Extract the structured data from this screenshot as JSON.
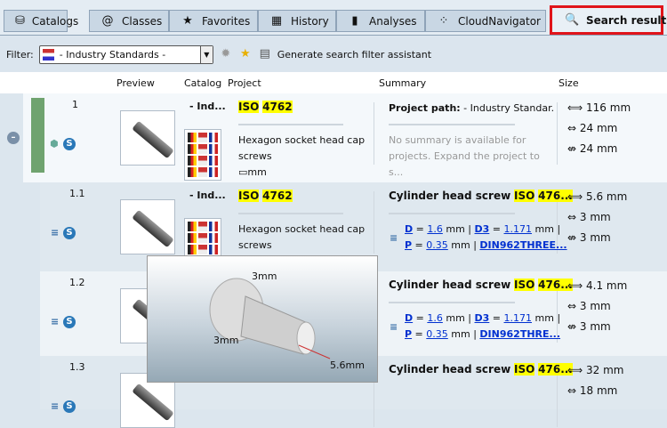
{
  "tabs": [
    {
      "label": "Catalogs",
      "icon": "catalogs-icon",
      "glyph": "⛁"
    },
    {
      "label": "Classes",
      "icon": "at-icon",
      "glyph": "@"
    },
    {
      "label": "Favorites",
      "icon": "star-icon",
      "glyph": "★"
    },
    {
      "label": "History",
      "icon": "calendar-icon",
      "glyph": "▦"
    },
    {
      "label": "Analyses",
      "icon": "bar-chart-icon",
      "glyph": "▮"
    },
    {
      "label": "CloudNavigator",
      "icon": "cloud-navigator-icon",
      "glyph": "⁘"
    },
    {
      "label": "Search results",
      "icon": "search-icon",
      "glyph": "🔍"
    }
  ],
  "filter": {
    "label": "Filter:",
    "value": "- Industry Standards -",
    "assistant": "Generate search filter assistant"
  },
  "columns": {
    "preview": "Preview",
    "catalog": "Catalog",
    "project": "Project",
    "summary": "Summary",
    "size": "Size"
  },
  "rows": [
    {
      "num": "1",
      "catalog": "- Ind...",
      "iso": "ISO",
      "code": "4762",
      "desc": "Hexagon socket head cap screws",
      "unit": "mm",
      "path_label": "Project path:",
      "path": "- Industry Standar...",
      "nosummary": "No summary is available for projects. Expand the project to s...",
      "sizes": [
        "116 mm",
        "24 mm",
        "24 mm"
      ]
    },
    {
      "num": "1.1",
      "catalog": "- Ind...",
      "iso": "ISO",
      "code": "4762",
      "desc": "Hexagon socket head cap screws",
      "title": "Cylinder head screw",
      "title_iso": "ISO",
      "title_code": "476...",
      "params": {
        "D": "D",
        "Dv": "1.6",
        "D3": "D3",
        "D3v": "1.171",
        "P": "P",
        "Pv": "0.35",
        "unit": "mm",
        "thread": "DIN962THREE..."
      },
      "sizes": [
        "5.6 mm",
        "3 mm",
        "3 mm"
      ]
    },
    {
      "num": "1.2",
      "title": "Cylinder head screw",
      "title_iso": "ISO",
      "title_code": "476...",
      "params": {
        "D": "D",
        "Dv": "1.6",
        "D3": "D3",
        "D3v": "1.171",
        "P": "P",
        "Pv": "0.35",
        "unit": "mm",
        "thread": "DIN962THRE..."
      },
      "sizes": [
        "4.1 mm",
        "3 mm",
        "3 mm"
      ]
    },
    {
      "num": "1.3",
      "title": "Cylinder head screw",
      "title_iso": "ISO",
      "title_code": "476...",
      "sizes": [
        "32 mm",
        "18 mm"
      ]
    }
  ],
  "popup": {
    "dim_top": "3mm",
    "dim_left": "3mm",
    "dim_right": "5.6mm"
  }
}
